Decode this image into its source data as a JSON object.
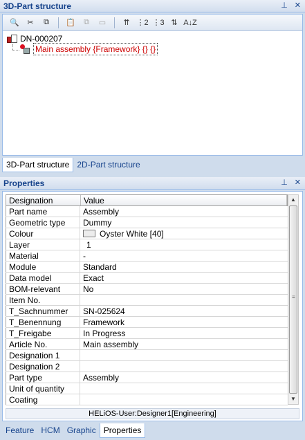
{
  "top_panel": {
    "title": "3D-Part structure",
    "pin_icon": "pin-icon",
    "close_icon": "close-icon"
  },
  "toolbar": {
    "buttons": [
      {
        "icon": "preview-icon",
        "glyph": "🔍",
        "enabled": true
      },
      {
        "icon": "cut-icon",
        "glyph": "✂",
        "enabled": true
      },
      {
        "icon": "copy-icon",
        "glyph": "⧉",
        "enabled": true
      },
      {
        "icon": "paste-icon",
        "glyph": "📋",
        "enabled": false
      },
      {
        "icon": "copy-structure-icon",
        "glyph": "⧉",
        "enabled": false
      },
      {
        "icon": "paste-structure-icon",
        "glyph": "▭",
        "enabled": false
      },
      {
        "icon": "sort-top-icon",
        "glyph": "⇈",
        "enabled": true
      },
      {
        "icon": "sort-2-icon",
        "glyph": "⋮2",
        "enabled": true
      },
      {
        "icon": "sort-3-icon",
        "glyph": "⋮3",
        "enabled": true
      },
      {
        "icon": "sort-updown-icon",
        "glyph": "⇅",
        "enabled": true
      },
      {
        "icon": "sort-az-icon",
        "glyph": "A↓Z",
        "enabled": true
      }
    ]
  },
  "tree": {
    "root_label": "DN-000207",
    "child_label": "Main assembly {Framework} {} {}"
  },
  "structure_tabs": [
    {
      "label": "3D-Part structure",
      "active": true
    },
    {
      "label": "2D-Part structure",
      "active": false
    }
  ],
  "properties_panel": {
    "title": "Properties",
    "columns": [
      "Designation",
      "Value"
    ],
    "rows": [
      {
        "name": "Part name",
        "value": "Assembly"
      },
      {
        "name": "Geometric type",
        "value": "Dummy"
      },
      {
        "name": "Colour",
        "value": "Oyster White [40]",
        "swatch": "#ececec"
      },
      {
        "name": "Layer",
        "value": "1"
      },
      {
        "name": "Material",
        "value": "-"
      },
      {
        "name": "Module",
        "value": "Standard"
      },
      {
        "name": "Data model",
        "value": "Exact"
      },
      {
        "name": "BOM-relevant",
        "value": "No"
      },
      {
        "name": "Item No.",
        "value": ""
      },
      {
        "name": "T_Sachnummer",
        "value": "SN-025624"
      },
      {
        "name": "T_Benennung",
        "value": "Framework"
      },
      {
        "name": "T_Freigabe",
        "value": "In Progress"
      },
      {
        "name": "Article No.",
        "value": "Main assembly"
      },
      {
        "name": "Designation 1",
        "value": ""
      },
      {
        "name": "Designation 2",
        "value": ""
      },
      {
        "name": "Part type",
        "value": "Assembly"
      },
      {
        "name": "Unit of quantity",
        "value": ""
      },
      {
        "name": "Coating",
        "value": ""
      }
    ],
    "status": "HELiOS-User:Designer1[Engineering]"
  },
  "bottom_tabs": [
    {
      "label": "Feature",
      "active": false
    },
    {
      "label": "HCM",
      "active": false
    },
    {
      "label": "Graphic",
      "active": false
    },
    {
      "label": "Properties",
      "active": true
    }
  ],
  "colors": {
    "accent": "#15428b",
    "panel_bg": "#cfdcec",
    "child_text": "#cc0000"
  }
}
